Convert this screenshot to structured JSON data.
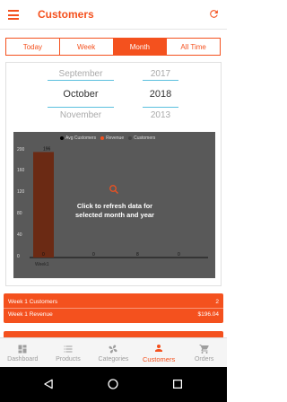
{
  "header": {
    "title": "Customers",
    "menu_icon": "hamburger-menu-icon",
    "refresh_icon": "refresh-icon",
    "accent": "#f4511e"
  },
  "tabs": [
    {
      "label": "Today",
      "active": false
    },
    {
      "label": "Week",
      "active": false
    },
    {
      "label": "Month",
      "active": true
    },
    {
      "label": "All Time",
      "active": false
    }
  ],
  "month_picker": {
    "above": "September",
    "selected": "October",
    "below": "November"
  },
  "year_picker": {
    "above": "2017",
    "selected": "2018",
    "below": "2013"
  },
  "chart_data": {
    "type": "bar",
    "legend": [
      "Avg Customers",
      "Revenue",
      "Customers"
    ],
    "legend_colors": [
      "#000000",
      "#f4511e",
      "#444444"
    ],
    "y_ticks": [
      "200",
      "160",
      "120",
      "80",
      "40",
      "0"
    ],
    "ylim": [
      0,
      200
    ],
    "categories": [
      "Week1"
    ],
    "series": [
      {
        "name": "Revenue",
        "values": [
          196
        ]
      }
    ],
    "data_labels": [
      "196",
      "0",
      "0",
      "8",
      "0"
    ],
    "overlay_text": "Click to refresh data for selected month and year",
    "overlay_icon": "search-icon"
  },
  "summary": {
    "customers_label": "Week 1 Customers",
    "customers_value": "2",
    "revenue_label": "Week 1 Revenue",
    "revenue_value": "$196.04"
  },
  "bottom_nav": [
    {
      "label": "Dashboard",
      "icon": "dashboard-icon",
      "active": false
    },
    {
      "label": "Products",
      "icon": "list-icon",
      "active": false
    },
    {
      "label": "Categories",
      "icon": "fan-icon",
      "active": false
    },
    {
      "label": "Customers",
      "icon": "person-icon",
      "active": true
    },
    {
      "label": "Orders",
      "icon": "cart-icon",
      "active": false
    }
  ],
  "system_nav": [
    "back-icon",
    "home-icon",
    "recents-icon"
  ]
}
